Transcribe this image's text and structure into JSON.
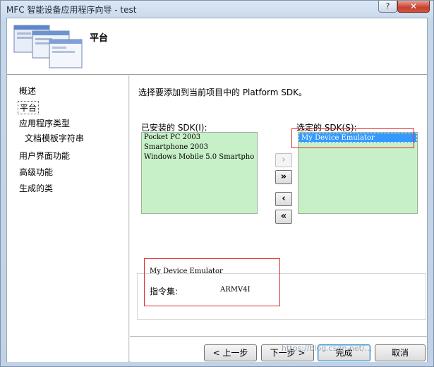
{
  "window": {
    "title": "MFC 智能设备应用程序向导 - test",
    "help_label": "?",
    "close_label": "✕"
  },
  "header": {
    "title": "平台"
  },
  "nav": {
    "items": [
      {
        "label": "概述"
      },
      {
        "label": "平台"
      },
      {
        "label": "应用程序类型"
      },
      {
        "label": "文档模板字符串"
      },
      {
        "label": "用户界面功能"
      },
      {
        "label": "高级功能"
      },
      {
        "label": "生成的类"
      }
    ]
  },
  "main": {
    "prompt": "选择要添加到当前项目中的 Platform SDK。",
    "installed_label": "已安装的 SDK(I):",
    "installed_items": [
      "Pocket PC 2003",
      "Smartphone 2003",
      "Windows Mobile 5.0 Smartpho"
    ],
    "selected_label": "选定的 SDK(S):",
    "selected_items": [
      "My Device Emulator"
    ],
    "move_buttons": {
      "add_one": "›",
      "add_all": "»",
      "remove_one": "‹",
      "remove_all": "«"
    },
    "info": {
      "device_name": "My Device Emulator",
      "isa_label": "指令集:",
      "isa_value": "ARMV4I"
    }
  },
  "buttons": {
    "back": "< 上一步",
    "next": "下一步 >",
    "finish": "完成",
    "cancel": "取消"
  },
  "watermark": "https://blog.csdn.net/..."
}
